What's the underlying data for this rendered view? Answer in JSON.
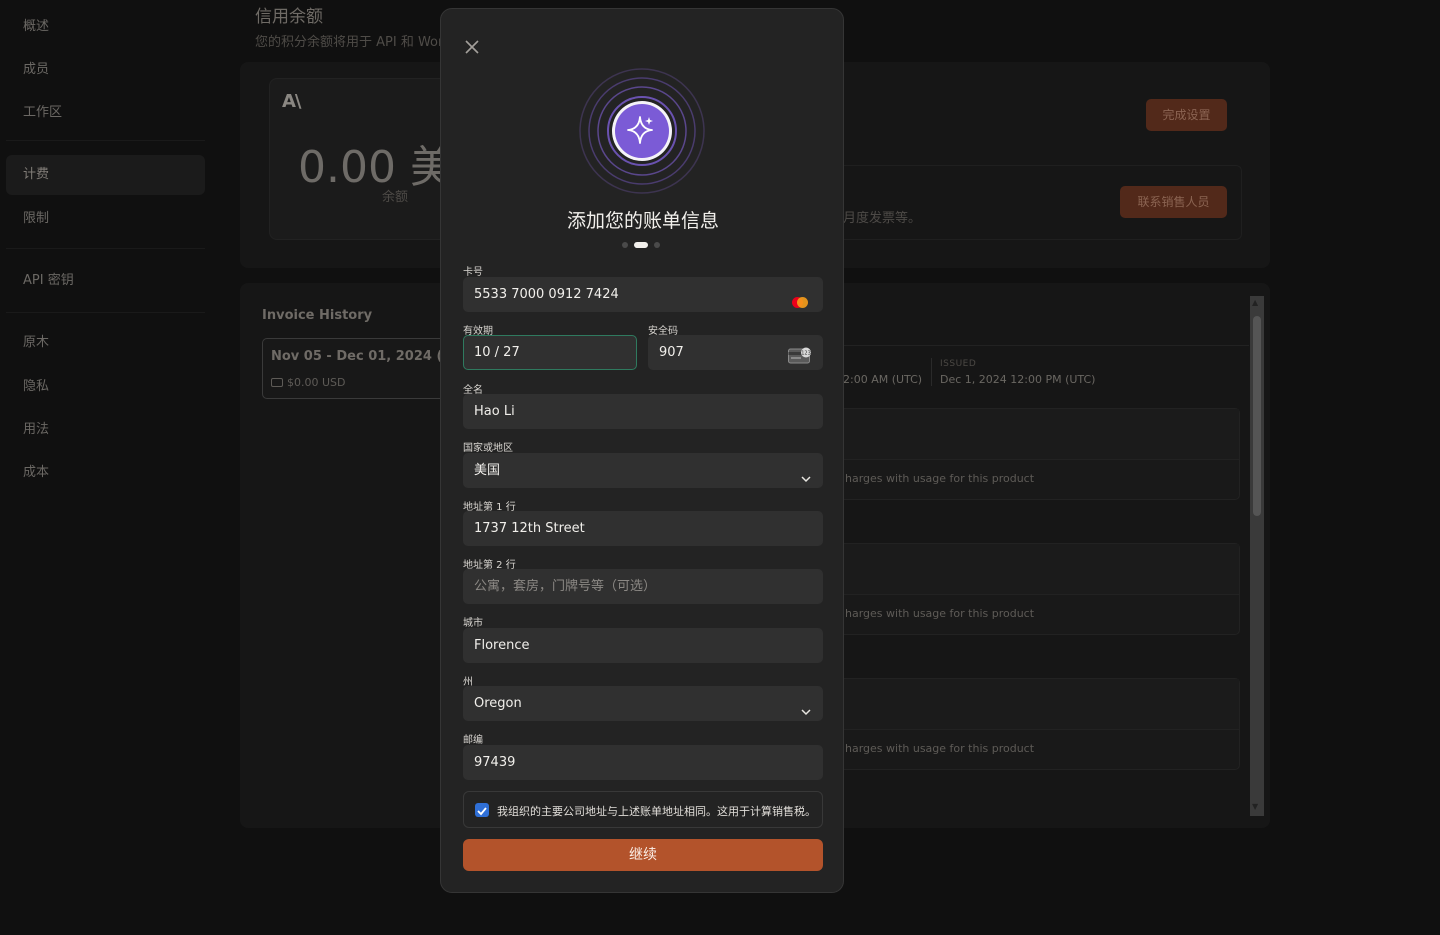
{
  "sidebar": {
    "items": [
      {
        "label": "概述"
      },
      {
        "label": "成员"
      },
      {
        "label": "工作区"
      },
      {
        "label": "计费"
      },
      {
        "label": "限制"
      },
      {
        "label": "API 密钥"
      },
      {
        "label": "原木"
      },
      {
        "label": "隐私"
      },
      {
        "label": "用法"
      },
      {
        "label": "成本"
      }
    ]
  },
  "credit": {
    "title": "信用余额",
    "subtitle": "您的积分余额将用于 API 和 Work",
    "logo": "A\\",
    "amount": "0.00 美",
    "amount_label": "余额",
    "setup_button": "完成设置",
    "sales_text": "月度发票等。",
    "sales_button": "联系销售人员"
  },
  "invoices": {
    "title": "Invoice History",
    "card_range": "Nov 05 - Dec 01, 2024 (UTC",
    "card_amount": "$0.00 USD",
    "col_a_value": "2:00 AM (UTC)",
    "issued_label": "ISSUED",
    "issued_value": "Dec 1, 2024 12:00 PM (UTC)",
    "charge_text": "harges with usage for this product"
  },
  "modal": {
    "title": "添加您的账单信息",
    "card_number_label": "卡号",
    "card_number": "5533 7000 0912 7424",
    "expiry_label": "有效期",
    "expiry": "10 / 27",
    "cvc_label": "安全码",
    "cvc": "907",
    "full_name_label": "全名",
    "full_name": "Hao Li",
    "country_label": "国家或地区",
    "country": "美国",
    "address1_label": "地址第 1 行",
    "address1": "1737 12th Street",
    "address2_label": "地址第 2 行",
    "address2_placeholder": "公寓，套房，门牌号等（可选）",
    "city_label": "城市",
    "city": "Florence",
    "state_label": "州",
    "state": "Oregon",
    "zip_label": "邮编",
    "zip": "97439",
    "agree_text": "我组织的主要公司地址与上述账单地址相同。这用于计算销售税。",
    "agree_checked": true,
    "continue_button": "继续",
    "steps_total": 3,
    "step_active": 2
  },
  "colors": {
    "accent": "#b3532b",
    "focus": "#2f7a5f",
    "checkbox": "#2f6fd6",
    "hero": "#7b5bd6"
  }
}
